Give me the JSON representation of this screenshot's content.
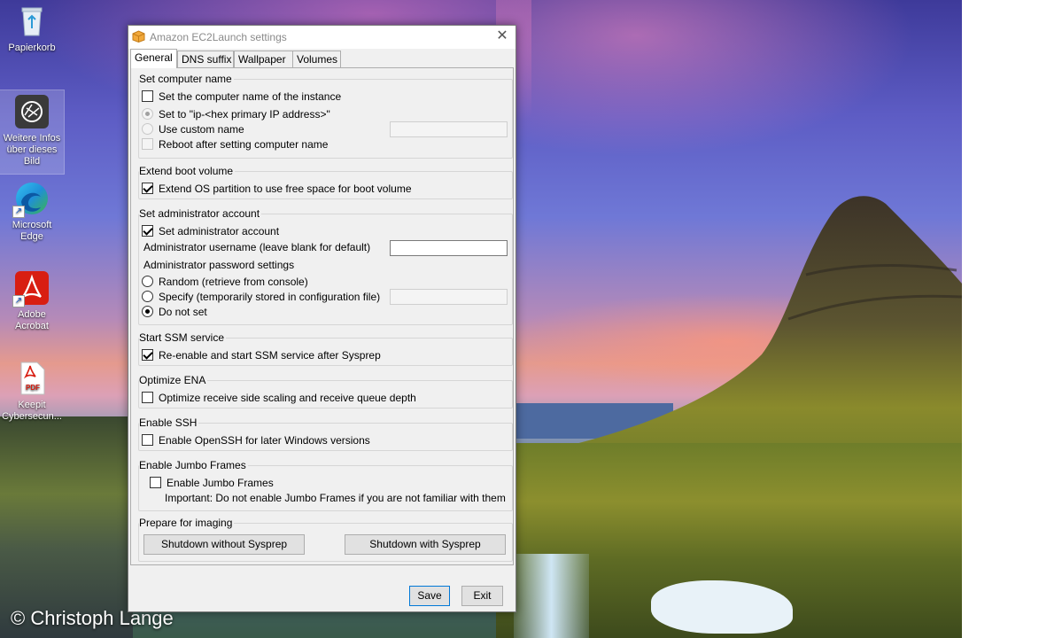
{
  "desktop": {
    "icons": [
      {
        "label": "Papierkorb"
      },
      {
        "label": "Weitere Infos über dieses Bild"
      },
      {
        "label": "Microsoft Edge"
      },
      {
        "label": "Adobe Acrobat"
      },
      {
        "label": "Keepit Cybersecun..."
      }
    ],
    "watermark": "© Christoph Lange"
  },
  "dialog": {
    "title": "Amazon EC2Launch settings",
    "close_glyph": "✕",
    "tabs": [
      "General",
      "DNS suffix",
      "Wallpaper",
      "Volumes"
    ],
    "active_tab": "General",
    "computer_name": {
      "title": "Set computer name",
      "set_name_label": "Set the computer name of the instance",
      "set_name_checked": false,
      "option_ip_label": "Set to \"ip-<hex primary IP address>\"",
      "option_custom_label": "Use custom name",
      "custom_name_value": "",
      "reboot_label": "Reboot after setting computer name"
    },
    "boot_volume": {
      "title": "Extend boot volume",
      "extend_label": "Extend OS partition to use free space for boot volume",
      "extend_checked": true
    },
    "admin": {
      "title": "Set administrator account",
      "set_admin_label": "Set administrator account",
      "set_admin_checked": true,
      "username_label": "Administrator username (leave blank for default)",
      "username_value": "",
      "password_settings_label": "Administrator password settings",
      "random_label": "Random (retrieve from console)",
      "specify_label": "Specify (temporarily stored in configuration file)",
      "specify_value": "",
      "not_set_label": "Do not set",
      "selected_option": "Do not set"
    },
    "ssm": {
      "title": "Start SSM service",
      "reenable_label": "Re-enable and start SSM service after Sysprep",
      "reenable_checked": true
    },
    "ena": {
      "title": "Optimize ENA",
      "optimize_label": "Optimize receive side scaling and receive queue depth",
      "optimize_checked": false
    },
    "ssh": {
      "title": "Enable SSH",
      "openssh_label": "Enable OpenSSH for later Windows versions",
      "openssh_checked": false
    },
    "jumbo": {
      "title": "Enable Jumbo Frames",
      "jumbo_label": "Enable Jumbo Frames",
      "jumbo_checked": false,
      "note": "Important: Do not enable Jumbo Frames if you are not familiar with them"
    },
    "imaging": {
      "title": "Prepare for imaging",
      "shutdown_without": "Shutdown without Sysprep",
      "shutdown_with": "Shutdown with Sysprep"
    },
    "footer": {
      "save": "Save",
      "exit": "Exit"
    }
  }
}
